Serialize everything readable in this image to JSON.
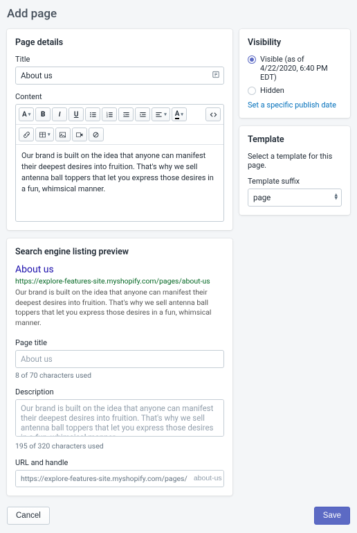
{
  "page_heading": "Add page",
  "page_details": {
    "heading": "Page details",
    "title_label": "Title",
    "title_value": "About us",
    "content_label": "Content",
    "content_value": "Our brand is built on the idea that anyone can manifest their deepest desires into fruition. That's why we sell antenna ball toppers that let you express those desires in a fun, whimsical manner.",
    "rte_icons": {
      "format": "A",
      "bold": "B",
      "italic": "I",
      "underline": "U",
      "align": "align",
      "color": "A",
      "html": "< >"
    }
  },
  "seo": {
    "heading": "Search engine listing preview",
    "preview_title": "About us",
    "preview_url": "https://explore-features-site.myshopify.com/pages/about-us",
    "preview_desc": "Our brand is built on the idea that anyone can manifest their deepest desires into fruition. That's why we sell antenna ball toppers that let you express those desires in a fun, whimsical manner.",
    "page_title_label": "Page title",
    "page_title_placeholder": "About us",
    "page_title_help": "8 of 70 characters used",
    "description_label": "Description",
    "description_placeholder": "Our brand is built on the idea that anyone can manifest their deepest desires into fruition. That's why we sell antenna ball toppers that let you express those desires in a fun, whimsical manner.",
    "description_help": "195 of 320 characters used",
    "url_label": "URL and handle",
    "url_prefix": "https://explore-features-site.myshopify.com/pages/",
    "url_handle": "about-us"
  },
  "visibility": {
    "heading": "Visibility",
    "visible_label": "Visible (as of 4/22/2020, 6:40 PM EDT)",
    "hidden_label": "Hidden",
    "link_text": "Set a specific publish date"
  },
  "template": {
    "heading": "Template",
    "subtext": "Select a template for this page.",
    "suffix_label": "Template suffix",
    "suffix_value": "page"
  },
  "footer": {
    "cancel": "Cancel",
    "save": "Save"
  }
}
